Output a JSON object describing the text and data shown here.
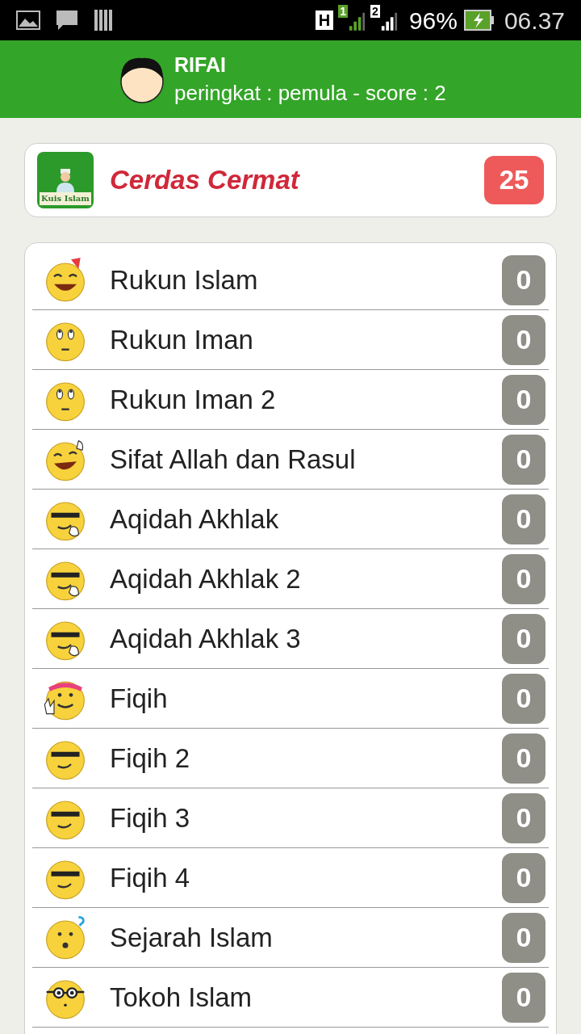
{
  "status_bar": {
    "network": "H",
    "sim_1": "1",
    "sim_2": "2",
    "battery": "96%",
    "time": "06.37"
  },
  "profile": {
    "name": "RIFAI",
    "subtitle": "peringkat : pemula - score : 2"
  },
  "category": {
    "title": "Cerdas Cermat",
    "count": "25",
    "logo_text": "Kuis Islam"
  },
  "topics": [
    {
      "label": "Rukun Islam",
      "count": "0",
      "kind": "party"
    },
    {
      "label": "Rukun Iman",
      "count": "0",
      "kind": "rolleyes"
    },
    {
      "label": "Rukun Iman 2",
      "count": "0",
      "kind": "rolleyes"
    },
    {
      "label": "Sifat Allah dan Rasul",
      "count": "0",
      "kind": "wave"
    },
    {
      "label": "Aqidah Akhlak",
      "count": "0",
      "kind": "cool"
    },
    {
      "label": "Aqidah Akhlak 2",
      "count": "0",
      "kind": "cool"
    },
    {
      "label": "Aqidah Akhlak 3",
      "count": "0",
      "kind": "cool"
    },
    {
      "label": "Fiqih",
      "count": "0",
      "kind": "peace"
    },
    {
      "label": "Fiqih 2",
      "count": "0",
      "kind": "shades"
    },
    {
      "label": "Fiqih 3",
      "count": "0",
      "kind": "shades"
    },
    {
      "label": "Fiqih 4",
      "count": "0",
      "kind": "shades"
    },
    {
      "label": "Sejarah Islam",
      "count": "0",
      "kind": "question"
    },
    {
      "label": "Tokoh Islam",
      "count": "0",
      "kind": "nerd"
    }
  ]
}
